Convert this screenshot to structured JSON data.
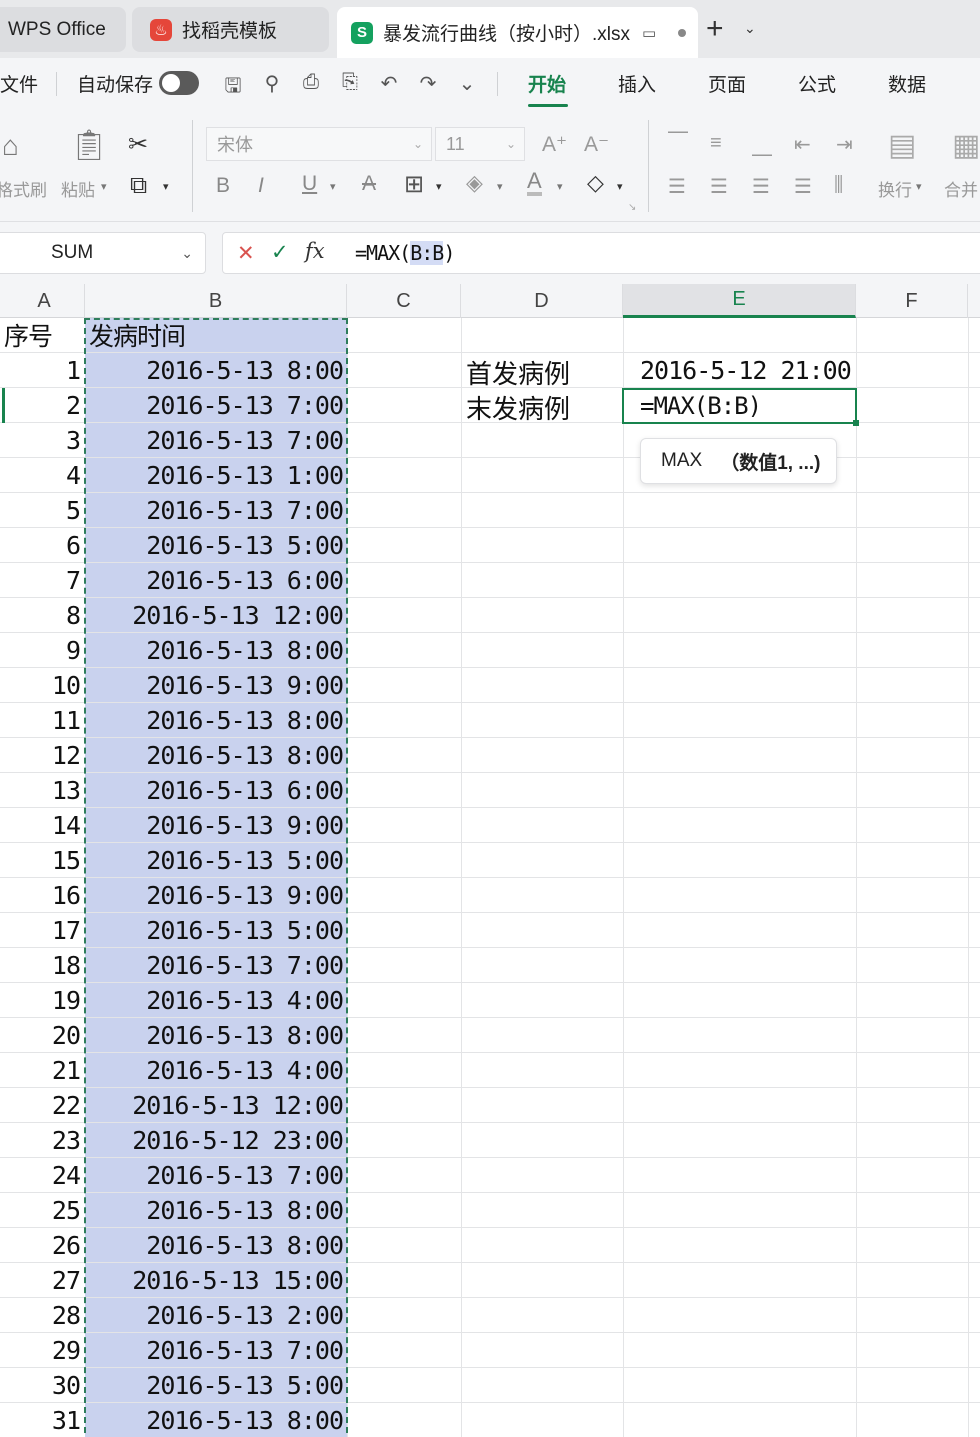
{
  "titlebar": {
    "app_tab": "WPS Office",
    "template_tab": "找稻壳模板",
    "file_tab": "暴发流行曲线（按小时）.xlsx",
    "s_logo": "S",
    "new_tab": "+"
  },
  "menu": {
    "file": "文件",
    "autosave": "自动保存",
    "tabs": [
      "开始",
      "插入",
      "页面",
      "公式",
      "数据"
    ]
  },
  "ribbon": {
    "format_painter": "格式刷",
    "paste": "粘贴",
    "font_name": "宋体",
    "font_size": "11",
    "wrap": "换行",
    "merge": "合并"
  },
  "formula_bar": {
    "name_box": "SUM",
    "fx": "fx",
    "formula_prefix": "=MAX(",
    "formula_ref": "B:B",
    "formula_suffix": ")"
  },
  "columns": [
    "A",
    "B",
    "C",
    "D",
    "E",
    "F"
  ],
  "sheet": {
    "header_a": "序号",
    "header_b": "发病时间",
    "rows": [
      {
        "n": "1",
        "t": "2016-5-13 8:00"
      },
      {
        "n": "2",
        "t": "2016-5-13 7:00"
      },
      {
        "n": "3",
        "t": "2016-5-13 7:00"
      },
      {
        "n": "4",
        "t": "2016-5-13 1:00"
      },
      {
        "n": "5",
        "t": "2016-5-13 7:00"
      },
      {
        "n": "6",
        "t": "2016-5-13 5:00"
      },
      {
        "n": "7",
        "t": "2016-5-13 6:00"
      },
      {
        "n": "8",
        "t": "2016-5-13 12:00"
      },
      {
        "n": "9",
        "t": "2016-5-13 8:00"
      },
      {
        "n": "10",
        "t": "2016-5-13 9:00"
      },
      {
        "n": "11",
        "t": "2016-5-13 8:00"
      },
      {
        "n": "12",
        "t": "2016-5-13 8:00"
      },
      {
        "n": "13",
        "t": "2016-5-13 6:00"
      },
      {
        "n": "14",
        "t": "2016-5-13 9:00"
      },
      {
        "n": "15",
        "t": "2016-5-13 5:00"
      },
      {
        "n": "16",
        "t": "2016-5-13 9:00"
      },
      {
        "n": "17",
        "t": "2016-5-13 5:00"
      },
      {
        "n": "18",
        "t": "2016-5-13 7:00"
      },
      {
        "n": "19",
        "t": "2016-5-13 4:00"
      },
      {
        "n": "20",
        "t": "2016-5-13 8:00"
      },
      {
        "n": "21",
        "t": "2016-5-13 4:00"
      },
      {
        "n": "22",
        "t": "2016-5-13 12:00"
      },
      {
        "n": "23",
        "t": "2016-5-12 23:00"
      },
      {
        "n": "24",
        "t": "2016-5-13 7:00"
      },
      {
        "n": "25",
        "t": "2016-5-13 8:00"
      },
      {
        "n": "26",
        "t": "2016-5-13 8:00"
      },
      {
        "n": "27",
        "t": "2016-5-13 15:00"
      },
      {
        "n": "28",
        "t": "2016-5-13 2:00"
      },
      {
        "n": "29",
        "t": "2016-5-13 7:00"
      },
      {
        "n": "30",
        "t": "2016-5-13 5:00"
      },
      {
        "n": "31",
        "t": "2016-5-13 8:00"
      }
    ],
    "first_case_label": "首发病例",
    "first_case_value": "2016-5-12 21:00",
    "last_case_label": "末发病例",
    "editing_formula": "=MAX(B:B)"
  },
  "tooltip": {
    "func": "MAX",
    "args": "（数值1, ...)"
  },
  "colors": {
    "accent": "#18834e",
    "selection": "#c9d2ee"
  }
}
